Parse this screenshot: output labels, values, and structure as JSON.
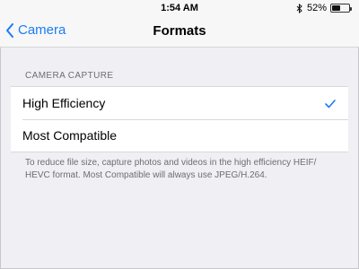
{
  "status_bar": {
    "time": "1:54 AM",
    "battery_percent": "52%",
    "battery_level": 0.52,
    "icons": [
      "bluetooth-icon",
      "battery-icon"
    ]
  },
  "nav": {
    "back_label": "Camera",
    "title": "Formats"
  },
  "section": {
    "header": "CAMERA CAPTURE",
    "options": [
      {
        "label": "High Efficiency",
        "selected": true
      },
      {
        "label": "Most Compatible",
        "selected": false
      }
    ],
    "footer": "To reduce file size, capture photos and videos in the high efficiency HEIF/ HEVC format. Most Compatible will always use JPEG/H.264."
  },
  "colors": {
    "accent": "#1a7cf5",
    "background": "#efeff4",
    "secondary_text": "#6d6d72"
  }
}
